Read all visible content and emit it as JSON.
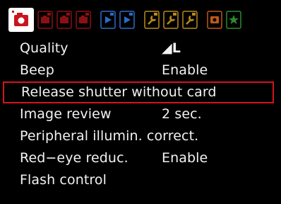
{
  "tabs": [
    {
      "name": "shooting-menu-1",
      "group": "shooting",
      "color": "#c8161e",
      "active": true
    },
    {
      "name": "shooting-menu-2",
      "group": "shooting",
      "color": "#c8161e"
    },
    {
      "name": "shooting-menu-3",
      "group": "shooting",
      "color": "#c8161e"
    },
    {
      "name": "shooting-menu-4",
      "group": "shooting",
      "color": "#c8161e"
    },
    {
      "name": "playback-menu-1",
      "group": "playback",
      "color": "#2a6cc8"
    },
    {
      "name": "playback-menu-2",
      "group": "playback",
      "color": "#2a6cc8"
    },
    {
      "name": "setup-menu-1",
      "group": "setup",
      "color": "#b88a1c"
    },
    {
      "name": "setup-menu-2",
      "group": "setup",
      "color": "#b88a1c"
    },
    {
      "name": "setup-menu-3",
      "group": "setup",
      "color": "#b88a1c"
    },
    {
      "name": "custom-functions",
      "group": "custom",
      "color": "#c0581a"
    },
    {
      "name": "my-menu",
      "group": "mymenu",
      "color": "#2e8a2e"
    }
  ],
  "menu": {
    "items": [
      {
        "label": "Quality",
        "value": "◢L",
        "selected": false
      },
      {
        "label": "Beep",
        "value": "Enable",
        "selected": false
      },
      {
        "label": "Release shutter without card",
        "value": "",
        "selected": true
      },
      {
        "label": "Image review",
        "value": "2 sec.",
        "selected": false
      },
      {
        "label": "Peripheral illumin. correct.",
        "value": "",
        "selected": false
      },
      {
        "label": "Red−eye reduc.",
        "value": "Enable",
        "selected": false
      },
      {
        "label": "Flash control",
        "value": "",
        "selected": false
      }
    ]
  },
  "colors": {
    "background": "#000000",
    "text": "#f2f2f2",
    "selection": "#d6141c"
  }
}
